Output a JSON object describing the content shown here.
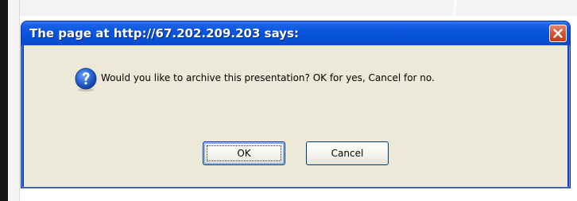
{
  "dialog": {
    "title": "The page at http://67.202.209.203 says:",
    "message": "Would you like to archive this presentation? OK for yes, Cancel for no.",
    "ok_label": "OK",
    "cancel_label": "Cancel",
    "icon": "question-icon",
    "close_icon": "close-icon"
  },
  "colors": {
    "titlebar": "#0a57e0",
    "body": "#ece9d8",
    "close_button": "#d5522f",
    "question_icon": "#1d5fd6"
  }
}
